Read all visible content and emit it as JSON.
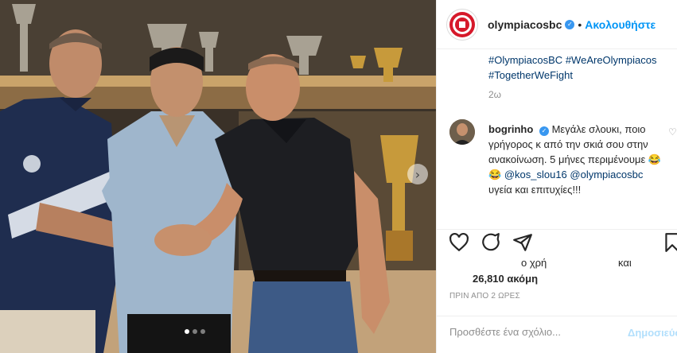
{
  "post": {
    "username": "olympiacosbc",
    "follow_label": "Ακολουθήστε",
    "separator": "•",
    "hashtags": [
      "#OlympiacosBC",
      "#WeAreOlympiacos",
      "#TogetherWeFight"
    ],
    "time_ago": "2ω",
    "carousel": {
      "dots": 3,
      "active": 0
    }
  },
  "comment": {
    "username": "bogrinho",
    "text_before": "Μεγάλε σλουκι, ποιο γρήγορος κ από την σκιά σου στην ανακοίνωση. 5 μήνες περιμένουμε 😂😂 ",
    "mention1": "@kos_slou16",
    "mention2": "@olympiacosbc",
    "text_after": " υγεία και επιτυχίες!!!"
  },
  "stats": {
    "partial1": "ο χρή",
    "partial2": "και",
    "likes": "26,810 ακόμη",
    "posted": "ΠΡΙΝ ΑΠΟ 2 ΩΡΕΣ"
  },
  "composer": {
    "placeholder": "Προσθέστε ένα σχόλιο...",
    "post_label": "Δημοσιεύστε"
  },
  "icons": [
    "verified-icon",
    "heart-icon",
    "comment-icon",
    "share-icon",
    "bookmark-icon",
    "chevron-right-icon"
  ],
  "colors": {
    "accent": "#0095f6",
    "verified": "#3897f0",
    "club_red": "#d6192a"
  }
}
